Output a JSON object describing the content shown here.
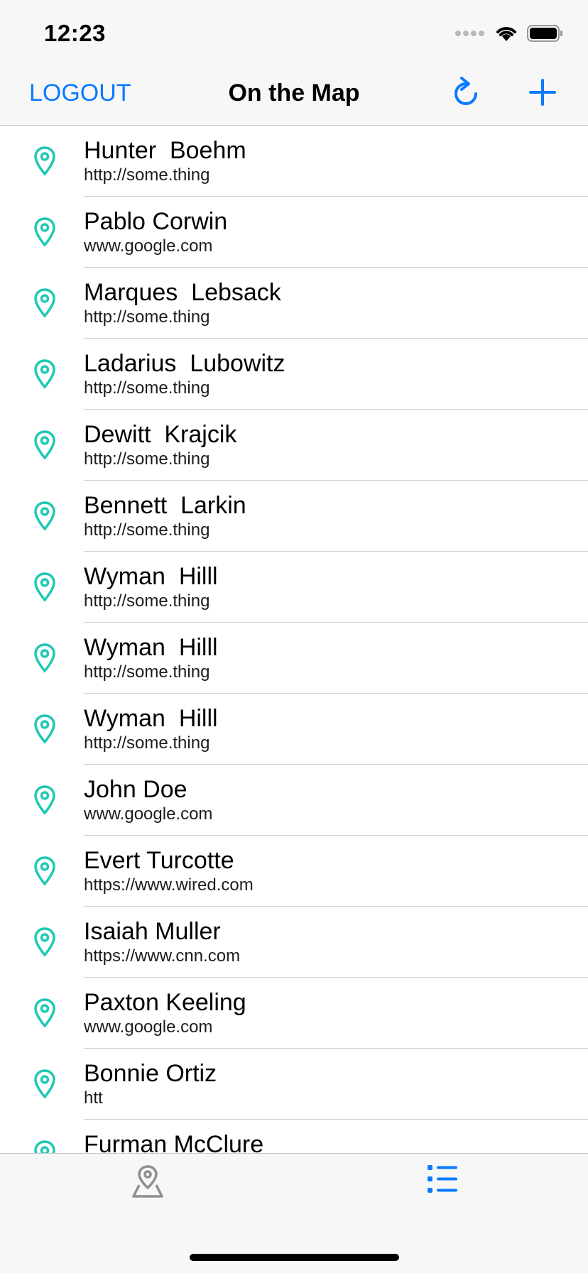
{
  "status_bar": {
    "time": "12:23"
  },
  "nav": {
    "logout_label": "LOGOUT",
    "title": "On the Map",
    "refresh_icon": "refresh-icon",
    "add_icon": "plus-icon"
  },
  "colors": {
    "accent": "#0a7aff",
    "pin": "#1ec8b4",
    "inactive_tab": "#8e8e93"
  },
  "students": [
    {
      "name": "Hunter  Boehm",
      "url": "http://some.thing"
    },
    {
      "name": "Pablo Corwin",
      "url": "www.google.com"
    },
    {
      "name": "Marques  Lebsack",
      "url": "http://some.thing"
    },
    {
      "name": "Ladarius  Lubowitz",
      "url": "http://some.thing"
    },
    {
      "name": "Dewitt  Krajcik",
      "url": "http://some.thing"
    },
    {
      "name": "Bennett  Larkin",
      "url": "http://some.thing"
    },
    {
      "name": "Wyman  Hilll",
      "url": "http://some.thing"
    },
    {
      "name": "Wyman  Hilll",
      "url": "http://some.thing"
    },
    {
      "name": "Wyman  Hilll",
      "url": "http://some.thing"
    },
    {
      "name": "John Doe",
      "url": "www.google.com"
    },
    {
      "name": "Evert Turcotte",
      "url": "https://www.wired.com"
    },
    {
      "name": "Isaiah Muller",
      "url": "https://www.cnn.com"
    },
    {
      "name": "Paxton Keeling",
      "url": "www.google.com"
    },
    {
      "name": "Bonnie Ortiz",
      "url": "htt"
    },
    {
      "name": "Furman McClure",
      "url": ""
    }
  ],
  "tabs": [
    {
      "icon": "map-tab-icon",
      "selected": false
    },
    {
      "icon": "list-tab-icon",
      "selected": true
    }
  ]
}
